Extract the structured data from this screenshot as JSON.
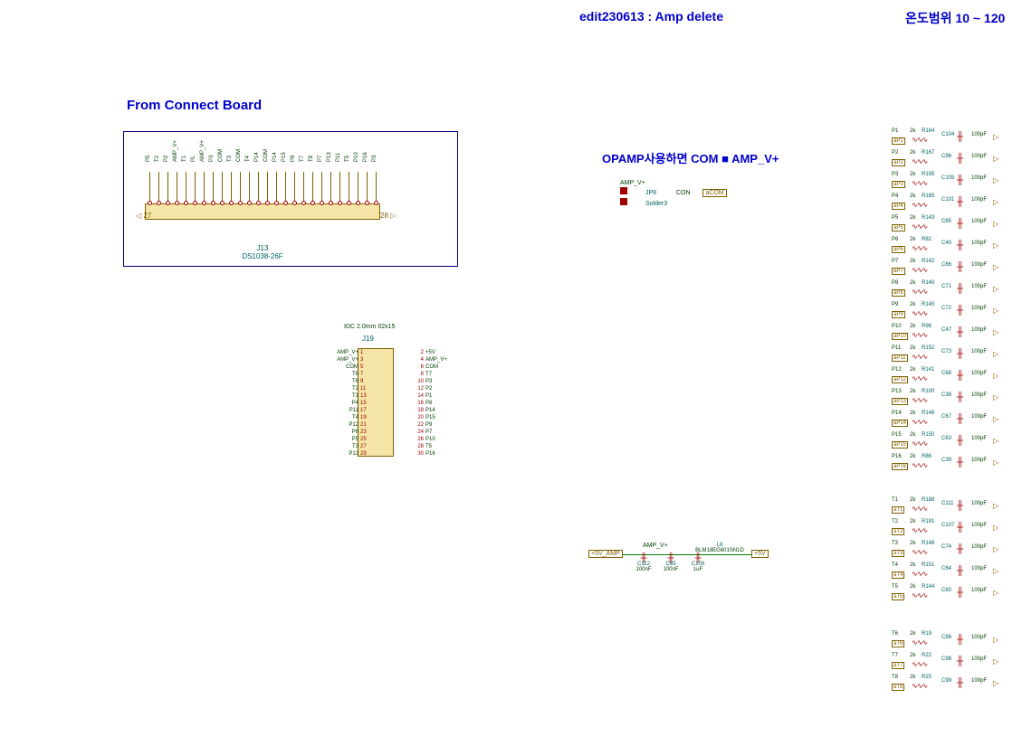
{
  "header": {
    "center": "edit230613 : Amp delete",
    "right": "온도범위 10 ~ 120"
  },
  "section_title": "From Connect Board",
  "connector": {
    "ref": "J13",
    "part": "DS1038-26F",
    "left_tag": "27",
    "right_tag": "28",
    "pins": [
      "P5",
      "T2",
      "P2",
      "AMP_V+",
      "T1",
      "PL",
      "AMP_V+",
      "P3",
      "COM",
      "T3",
      "COM",
      "T4",
      "P14",
      "COM",
      "P14",
      "P15",
      "P8",
      "T7",
      "T8",
      "P7",
      "P13",
      "P11",
      "T5",
      "P10",
      "P16",
      "P3"
    ]
  },
  "idc": {
    "title": "IDC 2.0mm 02x15",
    "ref": "J19",
    "rows": [
      {
        "l": "AMP_V+",
        "nl": "1",
        "nr": "2",
        "r": "+5V"
      },
      {
        "l": "AMP_V+",
        "nl": "3",
        "nr": "4",
        "r": "AMP_V+"
      },
      {
        "l": "COM",
        "nl": "5",
        "nr": "6",
        "r": "COM"
      },
      {
        "l": "T8",
        "nl": "7",
        "nr": "8",
        "r": "T7"
      },
      {
        "l": "T6",
        "nl": "9",
        "nr": "10",
        "r": "P3"
      },
      {
        "l": "T2",
        "nl": "11",
        "nr": "12",
        "r": "P2"
      },
      {
        "l": "T1",
        "nl": "13",
        "nr": "14",
        "r": "P1"
      },
      {
        "l": "P4",
        "nl": "15",
        "nr": "16",
        "r": "P8"
      },
      {
        "l": "P11",
        "nl": "17",
        "nr": "18",
        "r": "P14"
      },
      {
        "l": "T4",
        "nl": "19",
        "nr": "20",
        "r": "P15"
      },
      {
        "l": "P12",
        "nl": "21",
        "nr": "22",
        "r": "P9"
      },
      {
        "l": "P6",
        "nl": "23",
        "nr": "24",
        "r": "P7"
      },
      {
        "l": "P5",
        "nl": "25",
        "nr": "26",
        "r": "P10"
      },
      {
        "l": "T3",
        "nl": "27",
        "nr": "28",
        "r": "T5"
      },
      {
        "l": "P13",
        "nl": "29",
        "nr": "30",
        "r": "P16"
      }
    ]
  },
  "opamp_note": "OPAMP사용하면 COM ■ AMP_V+",
  "jp": {
    "amp_label": "AMP_V+",
    "ref": "JP8",
    "type": "Solder3",
    "con_label": "CON",
    "net": "aCOM"
  },
  "power": {
    "left_net": "+5V_AMP",
    "amp_label": "AMP_V+",
    "ferrite": {
      "ref": "L8",
      "part": "BLM18EG601SN1D"
    },
    "right_net": "+5V",
    "caps": [
      {
        "ref": "C112",
        "val": "100nF"
      },
      {
        "ref": "C93",
        "val": "100nF"
      },
      {
        "ref": "C109",
        "val": "1uF"
      }
    ]
  },
  "rc_p": [
    {
      "sig": "P1",
      "net": "aP1",
      "rv": "2k",
      "rr": "R184",
      "cr": "C104",
      "cv": "100pF"
    },
    {
      "sig": "P2",
      "net": "aP2",
      "rv": "2k",
      "rr": "R167",
      "cr": "C96",
      "cv": "100pF"
    },
    {
      "sig": "P3",
      "net": "aP3",
      "rv": "2k",
      "rr": "R195",
      "cr": "C105",
      "cv": "100pF"
    },
    {
      "sig": "P4",
      "net": "aP4",
      "rv": "2k",
      "rr": "R165",
      "cr": "C101",
      "cv": "100pF"
    },
    {
      "sig": "P5",
      "net": "aP5",
      "rv": "2k",
      "rr": "R143",
      "cr": "C65",
      "cv": "100pF"
    },
    {
      "sig": "P6",
      "net": "aP6",
      "rv": "2k",
      "rr": "R82",
      "cr": "C40",
      "cv": "100pF"
    },
    {
      "sig": "P7",
      "net": "aP7",
      "rv": "2k",
      "rr": "R142",
      "cr": "C66",
      "cv": "100pF"
    },
    {
      "sig": "P8",
      "net": "aP8",
      "rv": "2k",
      "rr": "R140",
      "cr": "C71",
      "cv": "100pF"
    },
    {
      "sig": "P9",
      "net": "aP9",
      "rv": "2k",
      "rr": "R145",
      "cr": "C72",
      "cv": "100pF"
    },
    {
      "sig": "P10",
      "net": "aP10",
      "rv": "2k",
      "rr": "R98",
      "cr": "C47",
      "cv": "100pF"
    },
    {
      "sig": "P11",
      "net": "aP11",
      "rv": "2k",
      "rr": "R152",
      "cr": "C73",
      "cv": "100pF"
    },
    {
      "sig": "P12",
      "net": "aP12",
      "rv": "2k",
      "rr": "R141",
      "cr": "C68",
      "cv": "100pF"
    },
    {
      "sig": "P13",
      "net": "aP13",
      "rv": "2k",
      "rr": "R100",
      "cr": "C38",
      "cv": "100pF"
    },
    {
      "sig": "P14",
      "net": "aP14",
      "rv": "2k",
      "rr": "R146",
      "cr": "C67",
      "cv": "100pF"
    },
    {
      "sig": "P15",
      "net": "aP15",
      "rv": "2k",
      "rr": "R150",
      "cr": "C63",
      "cv": "100pF"
    },
    {
      "sig": "P16",
      "net": "aP16",
      "rv": "2k",
      "rr": "R86",
      "cr": "C39",
      "cv": "100pF"
    }
  ],
  "rc_t1": [
    {
      "sig": "T1",
      "net": "aT1",
      "rv": "2k",
      "rr": "R188",
      "cr": "C111",
      "cv": "100pF"
    },
    {
      "sig": "T2",
      "net": "aT2",
      "rv": "2k",
      "rr": "R191",
      "cr": "C107",
      "cv": "100pF"
    },
    {
      "sig": "T3",
      "net": "aT3",
      "rv": "2k",
      "rr": "R148",
      "cr": "C74",
      "cv": "100pF"
    },
    {
      "sig": "T4",
      "net": "aT4",
      "rv": "2k",
      "rr": "R151",
      "cr": "C64",
      "cv": "100pF"
    },
    {
      "sig": "T5",
      "net": "aT5",
      "rv": "2k",
      "rr": "R144",
      "cr": "C60",
      "cv": "100pF"
    }
  ],
  "rc_t2": [
    {
      "sig": "T6",
      "net": "aT6",
      "rv": "2k",
      "rr": "R19",
      "cr": "C86",
      "cv": "100pF"
    },
    {
      "sig": "T7",
      "net": "aT7",
      "rv": "2k",
      "rr": "R22",
      "cr": "C98",
      "cv": "100pF"
    },
    {
      "sig": "T8",
      "net": "aT8",
      "rv": "2k",
      "rr": "R25",
      "cr": "C99",
      "cv": "100pF"
    }
  ]
}
